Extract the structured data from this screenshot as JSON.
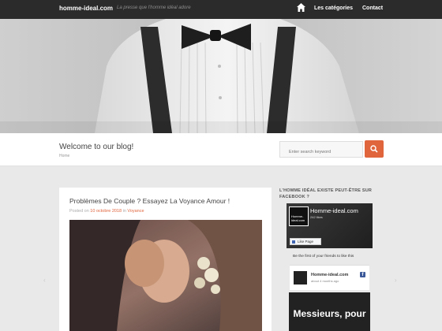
{
  "header": {
    "brand": "homme-ideal.com",
    "tagline": "La presse que l'homme idéal adore",
    "nav": {
      "categories": "Les catégories",
      "contact": "Contact"
    }
  },
  "welcome": {
    "title": "Welcome to our blog!",
    "breadcrumb": "Home",
    "search_placeholder": "Enter search keyword"
  },
  "post": {
    "title": "Problèmes De Couple ? Essayez La Voyance Amour !",
    "meta_prefix": "Posted on ",
    "date": "10 octobre 2018",
    "meta_in": " in ",
    "category": "Voyance"
  },
  "sidebar": {
    "title": "L'HOMME IDÉAL EXISTE PEUT-ÊTRE SUR FACEBOOK ?",
    "fb": {
      "page_name": "Homme-ideal.com",
      "thumb_text": "Homme-ideal.com",
      "likes": "242 likes",
      "like_button": "Like Page",
      "friends_text": "Be the first of your friends to like this",
      "post_name": "Homme-ideal.com",
      "post_time": "about 4 months ago"
    },
    "promo_text": "Messieurs, pour"
  },
  "colors": {
    "accent": "#e0643c",
    "topbar": "#2b2b2b"
  }
}
